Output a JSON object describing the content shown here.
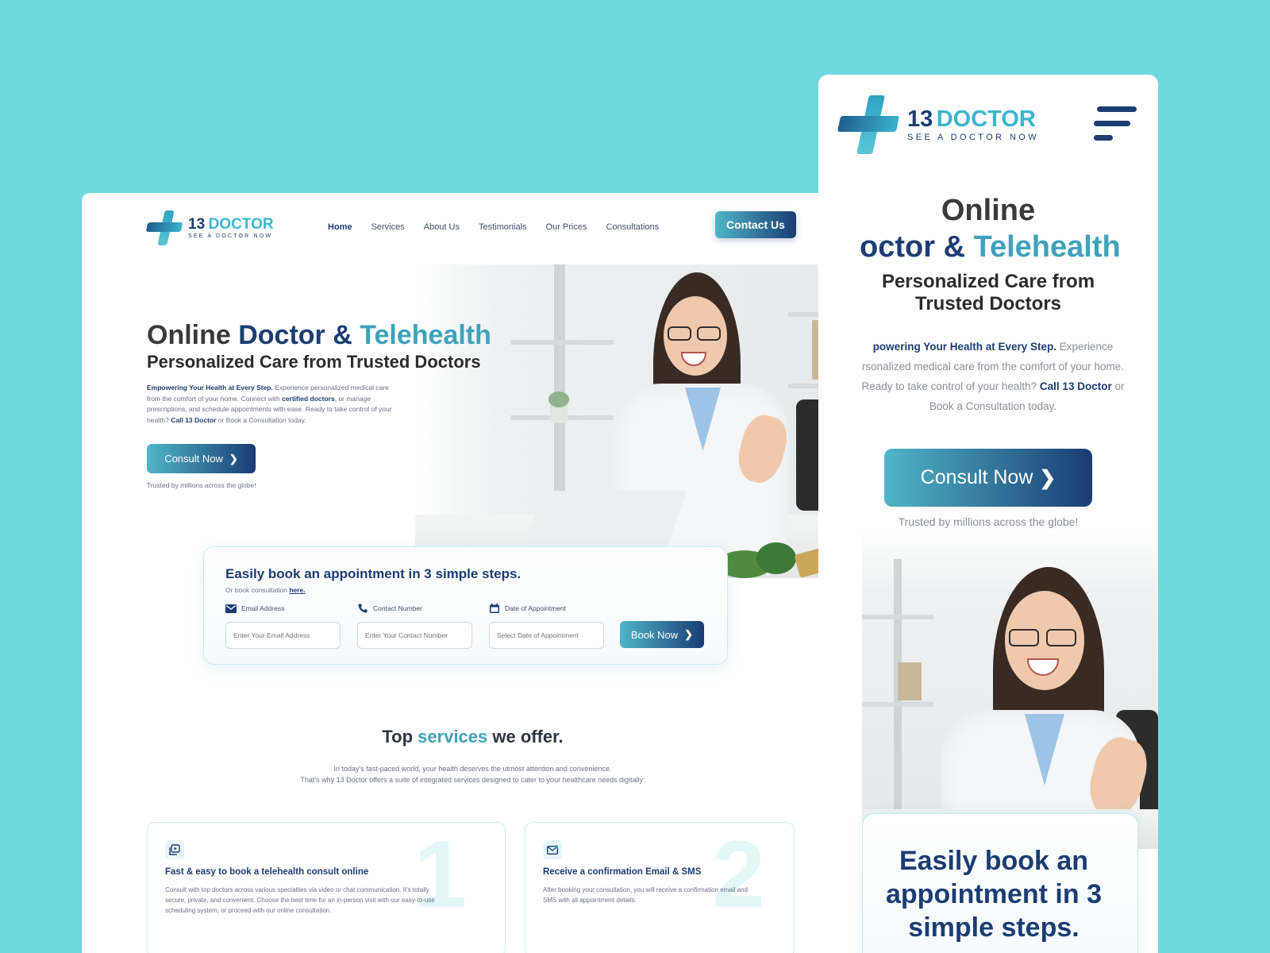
{
  "brand": {
    "number": "13",
    "word": "DOCTOR",
    "tagline": "SEE A DOCTOR NOW"
  },
  "nav": {
    "items": [
      "Home",
      "Services",
      "About Us",
      "Testimonials",
      "Our Prices",
      "Consultations"
    ],
    "active": "Home"
  },
  "header": {
    "contact_label": "Contact Us"
  },
  "hero": {
    "title_part1": "Online ",
    "title_part2": "Doctor",
    "title_part3": " & ",
    "title_part4": "Telehealth",
    "subtitle": "Personalized Care from Trusted Doctors",
    "intro_bold": "Empowering Your Health at Every Step.",
    "intro_text1": " Experience personalized medical care from the comfort of your home. Connect with ",
    "intro_link": "certified doctors",
    "intro_text2": ", or manage prescriptions, and schedule appointments with ease. Ready to take control of your health? ",
    "intro_call": "Call 13 Doctor",
    "intro_text3": " or Book a Consultation today.",
    "cta_label": "Consult Now",
    "trusted": "Trusted by millions across the globe!"
  },
  "booking": {
    "title": "Easily book an appointment in 3 simple steps.",
    "sub_text": "Or book consultation ",
    "sub_link": "here.",
    "fields": [
      {
        "label": "Email Address",
        "placeholder": "Enter Your Email Address",
        "icon": "mail-icon"
      },
      {
        "label": "Contact Number",
        "placeholder": "Enter Your Contact Number",
        "icon": "phone-icon"
      },
      {
        "label": "Date of Appointment",
        "placeholder": "Select Date of Appointment",
        "icon": "calendar-icon"
      }
    ],
    "button_label": "Book Now"
  },
  "services": {
    "title_part1": "Top ",
    "title_part2": "services",
    "title_part3": " we offer.",
    "intro_line1": "In today's fast-paced world, your health deserves the utmost attention and convenience.",
    "intro_line2": "That's why 13 Doctor offers a suite of integrated services designed to cater to your healthcare needs digitally:",
    "cards": [
      {
        "number": "1",
        "title": "Fast & easy to book a telehealth consult online",
        "line1": "Consult with top doctors across various specialties via video or chat communication. It's totally",
        "line2": "secure, private, and convenient. Choose the best time for an in-person visit with our easy-to-use",
        "line3": "scheduling system, or proceed with our online consultation.",
        "icon": "video-consult-icon"
      },
      {
        "number": "2",
        "title": "Receive a confirmation Email & SMS",
        "line1": "After booking your consultation, you will receive a confirmation email and",
        "line2": "SMS with all appointment details.",
        "line3": "",
        "icon": "email-confirm-icon"
      }
    ]
  },
  "mobile": {
    "title_line1": "Online",
    "title_line2_a": "octor",
    "title_line2_b": " & ",
    "title_line2_c": "Telehealth",
    "subtitle_line1": "Personalized Care from",
    "subtitle_line2": "Trusted Doctors",
    "p_bold": "powering Your Health at Every Step.",
    "p_text1": " Experience rsonalized medical care from the comfort of your home. Ready to take control of your health? ",
    "p_call": "Call 13 Doctor",
    "p_text2": " or Book a Consultation today.",
    "cta_label": "Consult Now",
    "trusted": "Trusted by millions across the globe!",
    "booking_title": "Easily book an appointment in 3 simple steps."
  },
  "colors": {
    "background": "#6fd8de",
    "navy": "#1b3d73",
    "teal": "#3ea2bb"
  }
}
